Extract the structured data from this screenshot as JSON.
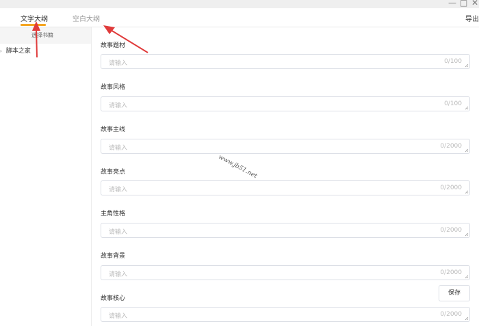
{
  "window": {
    "minimize_glyph": "—",
    "maximize_glyph": "□",
    "close_glyph": "✕"
  },
  "tabs": [
    {
      "label": "文字大纲",
      "active": true
    },
    {
      "label": "空白大纲",
      "active": false
    }
  ],
  "export_label": "导出",
  "sidebar": {
    "header": "选择书籍",
    "items": [
      {
        "label": "脚本之家",
        "caret": "›"
      }
    ]
  },
  "fields": [
    {
      "label": "故事题材",
      "placeholder": "请输入",
      "count": "0/100"
    },
    {
      "label": "故事风格",
      "placeholder": "请输入",
      "count": "0/100"
    },
    {
      "label": "故事主线",
      "placeholder": "请输入",
      "count": "0/2000"
    },
    {
      "label": "故事亮点",
      "placeholder": "请输入",
      "count": "0/2000"
    },
    {
      "label": "主角性格",
      "placeholder": "请输入",
      "count": "0/2000"
    },
    {
      "label": "故事背景",
      "placeholder": "请输入",
      "count": "0/2000"
    },
    {
      "label": "故事核心",
      "placeholder": "请输入",
      "count": "0/2000"
    }
  ],
  "save_label": "保存",
  "watermark": "www.jb51.net",
  "colors": {
    "accent": "#f5a623",
    "arrow": "#e03b3b",
    "border": "#dcdfe6"
  },
  "icons": {
    "tree_caret": "chevron-right-icon"
  }
}
